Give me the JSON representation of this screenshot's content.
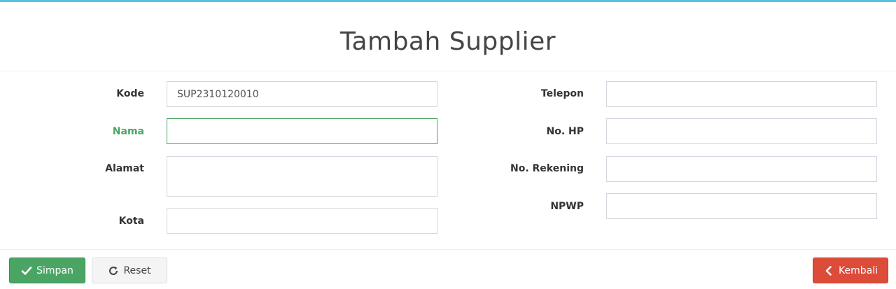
{
  "header": {
    "title": "Tambah Supplier"
  },
  "form": {
    "kode": {
      "label": "Kode",
      "value": "SUP2310120010"
    },
    "nama": {
      "label": "Nama",
      "value": ""
    },
    "alamat": {
      "label": "Alamat",
      "value": ""
    },
    "kota": {
      "label": "Kota",
      "value": ""
    },
    "telepon": {
      "label": "Telepon",
      "value": ""
    },
    "no_hp": {
      "label": "No. HP",
      "value": ""
    },
    "no_rekening": {
      "label": "No. Rekening",
      "value": ""
    },
    "npwp": {
      "label": "NPWP",
      "value": ""
    }
  },
  "footer": {
    "save_label": "Simpan",
    "reset_label": "Reset",
    "back_label": "Kembali"
  },
  "colors": {
    "header_border": "#5bc0de",
    "success": "#4aa564",
    "danger": "#dd4b39"
  },
  "icons": {
    "save": "check-icon",
    "reset": "refresh-icon",
    "back": "chevron-left-icon"
  }
}
